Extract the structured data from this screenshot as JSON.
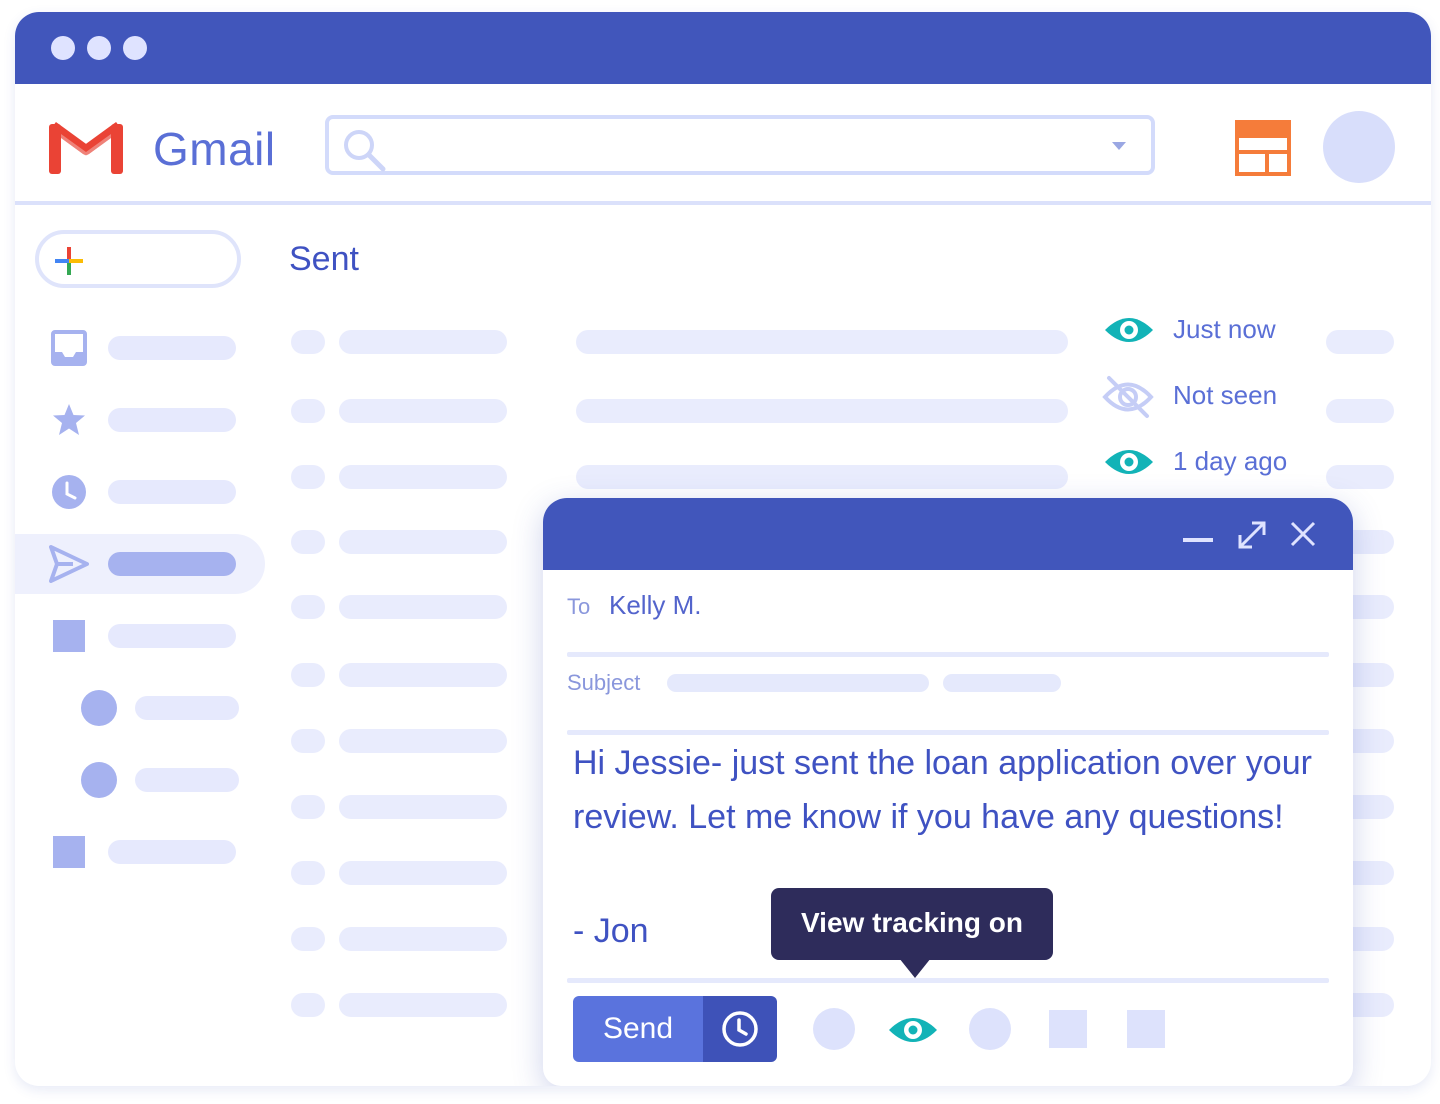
{
  "app": {
    "brand": "Gmail",
    "colors": {
      "primary": "#4156bb",
      "accent_teal": "#12b3b7",
      "layout_icon": "#f57c3a",
      "tooltip_bg": "#2e2c5b"
    }
  },
  "search": {
    "value": "",
    "placeholder": ""
  },
  "icons": [
    "gmail-logo-icon",
    "search-icon",
    "dropdown-caret-icon",
    "layout-icon",
    "plus-icon",
    "inbox-icon",
    "star-icon",
    "clock-icon",
    "send-icon",
    "eye-icon",
    "eye-off-icon",
    "minimize-icon",
    "expand-icon",
    "close-icon",
    "schedule-clock-icon"
  ],
  "folder": {
    "title": "Sent"
  },
  "tracking": [
    {
      "status": "seen",
      "label": "Just now"
    },
    {
      "status": "not-seen",
      "label": "Not seen"
    },
    {
      "status": "seen",
      "label": "1 day ago"
    }
  ],
  "compose": {
    "to_label": "To",
    "to_value": "Kelly M.",
    "subject_label": "Subject",
    "body": "Hi Jessie- just sent the loan application over your review. Let me know if you have any questions!",
    "signature": "- Jon",
    "tooltip": "View tracking on",
    "send_label": "Send"
  }
}
